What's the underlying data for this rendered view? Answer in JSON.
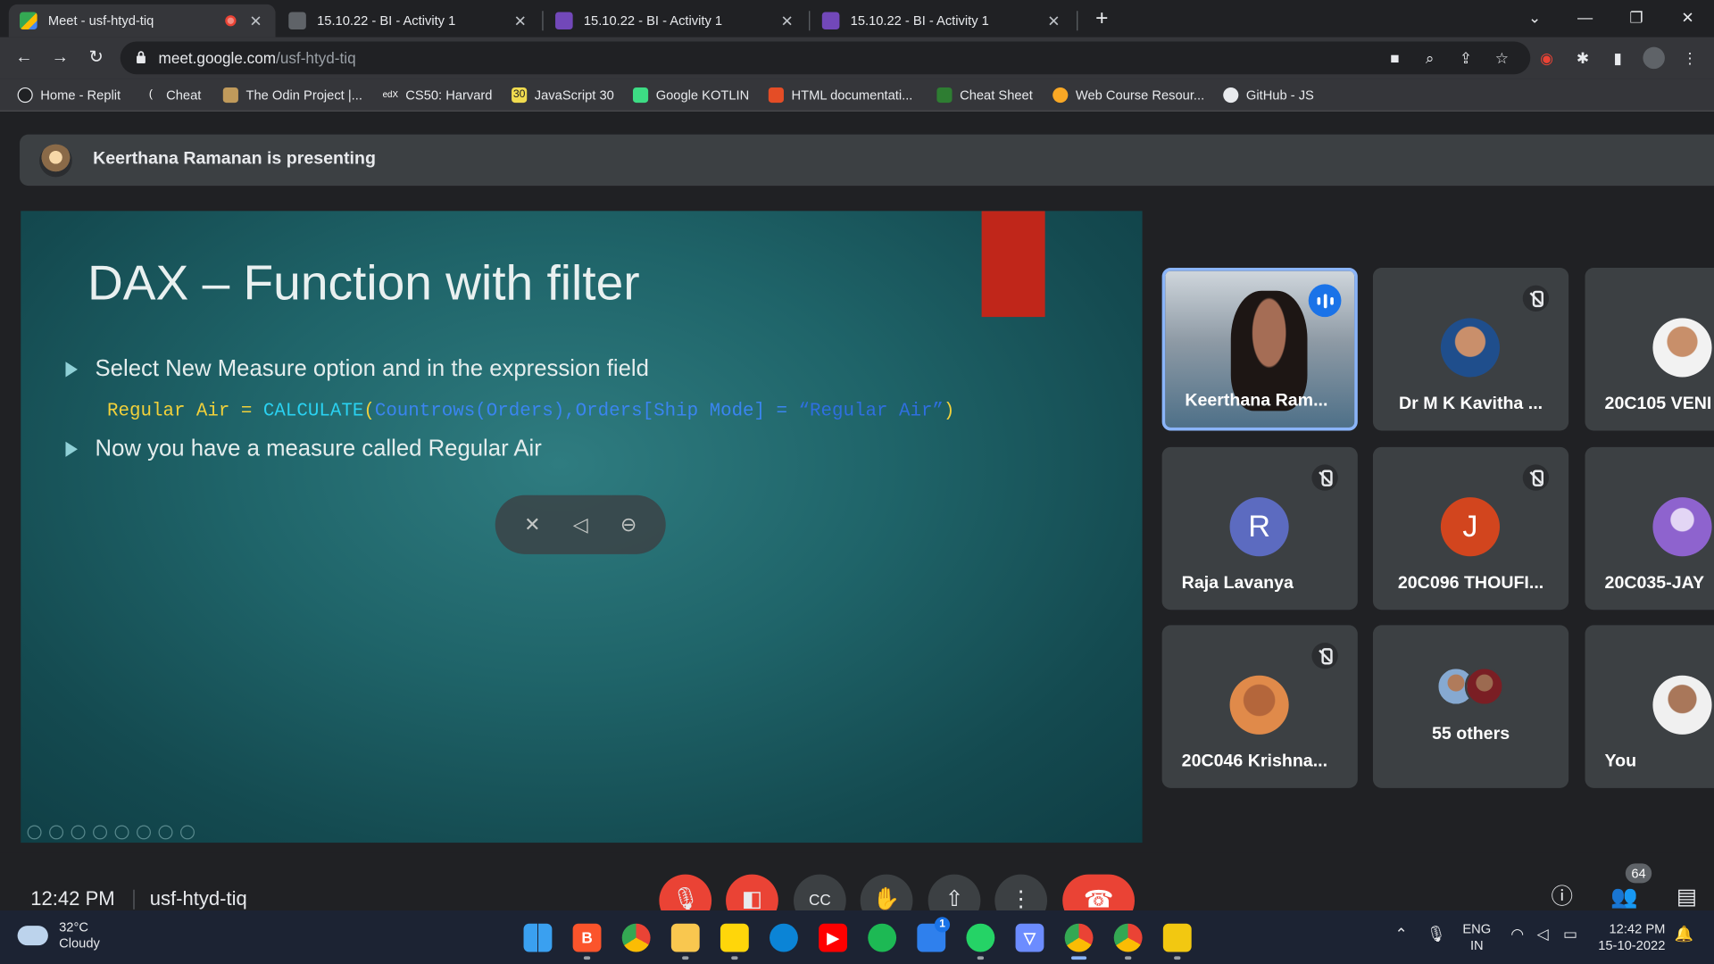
{
  "browser": {
    "tabs": [
      {
        "title": "Meet - usf-htyd-tiq",
        "active": true,
        "recording": true
      },
      {
        "title": "15.10.22 - BI - Activity 1",
        "active": false
      },
      {
        "title": "15.10.22 - BI - Activity 1",
        "active": false
      },
      {
        "title": "15.10.22 - BI - Activity 1",
        "active": false
      }
    ],
    "url_host": "meet.google.com",
    "url_path": "/usf-htyd-tiq",
    "bookmarks": [
      {
        "label": "Home - Replit"
      },
      {
        "label": "Cheat"
      },
      {
        "label": "The Odin Project |..."
      },
      {
        "label": "CS50: Harvard"
      },
      {
        "label": "JavaScript 30"
      },
      {
        "label": "Google KOTLIN"
      },
      {
        "label": "HTML documentati..."
      },
      {
        "label": "Cheat Sheet"
      },
      {
        "label": "Web Course Resour..."
      },
      {
        "label": "GitHub - JS"
      }
    ]
  },
  "meet": {
    "presenting_banner": "Keerthana Ramanan is presenting",
    "slide": {
      "title": "DAX – Function with filter",
      "bullet1": "Select New Measure option and in the expression field",
      "code": {
        "part1": "Regular Air = ",
        "part2": "CALCULATE",
        "part3": "(",
        "part4": "Countrows(Orders),Orders[Ship Mode] = ",
        "part5": "“Regular Air”",
        "part6": ")"
      },
      "bullet2": "Now you have a measure called Regular Air"
    },
    "participants": [
      {
        "name": "Keerthana Ram...",
        "speaking": true
      },
      {
        "name": "Dr M K Kavitha ...",
        "muted": true
      },
      {
        "name": "20C105 VENI"
      },
      {
        "name": "Raja Lavanya",
        "initial": "R",
        "color": "#5c6bc0",
        "muted": true
      },
      {
        "name": "20C096 THOUFI...",
        "initial": "J",
        "color": "#d2451e",
        "muted": true
      },
      {
        "name": "20C035-JAY"
      },
      {
        "name": "20C046 Krishna...",
        "muted": true
      },
      {
        "name": "55 others"
      },
      {
        "name": "You"
      }
    ],
    "call": {
      "time": "12:42 PM",
      "meeting_code": "usf-htyd-tiq",
      "participant_count": "64"
    }
  },
  "taskbar": {
    "temperature": "32°C",
    "weather": "Cloudy",
    "lang": "ENG",
    "region": "IN",
    "time": "12:42 PM",
    "date": "15-10-2022",
    "badge": "1"
  }
}
